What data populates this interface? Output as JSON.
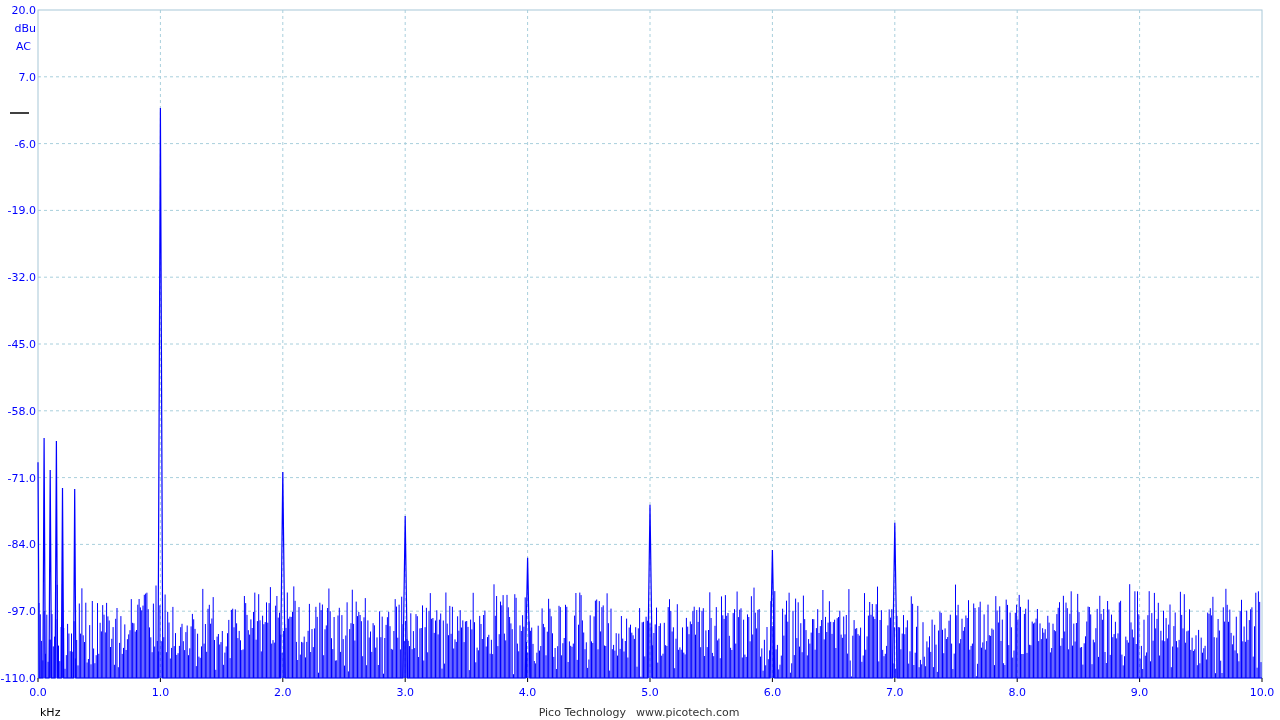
{
  "chart": {
    "coupling": "AC",
    "chart_data": {
      "type": "line",
      "grid": true,
      "xlabel": "kHz",
      "ylabel": "dBu",
      "xlim": [
        0,
        10
      ],
      "ylim": [
        -110,
        20
      ],
      "xticks": [
        {
          "value": 0,
          "label": "0.0"
        },
        {
          "value": 1,
          "label": "1.0"
        },
        {
          "value": 2,
          "label": "2.0"
        },
        {
          "value": 3,
          "label": "3.0"
        },
        {
          "value": 4,
          "label": "4.0"
        },
        {
          "value": 5,
          "label": "5.0"
        },
        {
          "value": 6,
          "label": "6.0"
        },
        {
          "value": 7,
          "label": "7.0"
        },
        {
          "value": 8,
          "label": "8.0"
        },
        {
          "value": 9,
          "label": "9.0"
        },
        {
          "value": 10,
          "label": "10.0"
        }
      ],
      "yticks": [
        {
          "value": 20,
          "label": "20.0"
        },
        {
          "value": 7,
          "label": "7.0"
        },
        {
          "value": -6,
          "label": "-6.0"
        },
        {
          "value": -19,
          "label": "-19.0"
        },
        {
          "value": -32,
          "label": "-32.0"
        },
        {
          "value": -45,
          "label": "-45.0"
        },
        {
          "value": -58,
          "label": "-58.0"
        },
        {
          "value": -71,
          "label": "-71.0"
        },
        {
          "value": -84,
          "label": "-84.0"
        },
        {
          "value": -97,
          "label": "-97.0"
        },
        {
          "value": -110,
          "label": "-110.0"
        }
      ],
      "x": [
        0,
        0.01,
        0.04,
        0.05,
        0.06,
        0.09,
        0.1,
        0.11,
        0.14,
        0.15,
        0.16,
        0.19,
        0.2,
        0.21,
        0.29,
        0.3,
        0.31,
        0.98,
        1.0,
        1.02,
        1.98,
        2.0,
        2.02,
        2.98,
        3.0,
        3.02,
        3.98,
        4.0,
        4.02,
        4.98,
        5.0,
        5.02,
        5.98,
        6.0,
        6.02,
        6.98,
        7.0,
        7.02,
        10
      ],
      "series": [
        {
          "color": "#0000ff",
          "values": [
            -68,
            -110,
            -110,
            -63.3,
            -110,
            -110,
            -69.5,
            -110,
            -110,
            -63.9,
            -110,
            -110,
            -73,
            -110,
            -110,
            -73.2,
            -110,
            -110,
            0.9,
            -110,
            -110,
            -69.9,
            -110,
            -110,
            -78.5,
            -110,
            -110,
            -86.6,
            -110,
            -110,
            -76.3,
            -110,
            -110,
            -85.1,
            -110,
            -110,
            -79.8,
            -110,
            -110
          ]
        }
      ]
    }
  },
  "footer": {
    "company": "Pico Technology",
    "website": "www.picotech.com"
  }
}
